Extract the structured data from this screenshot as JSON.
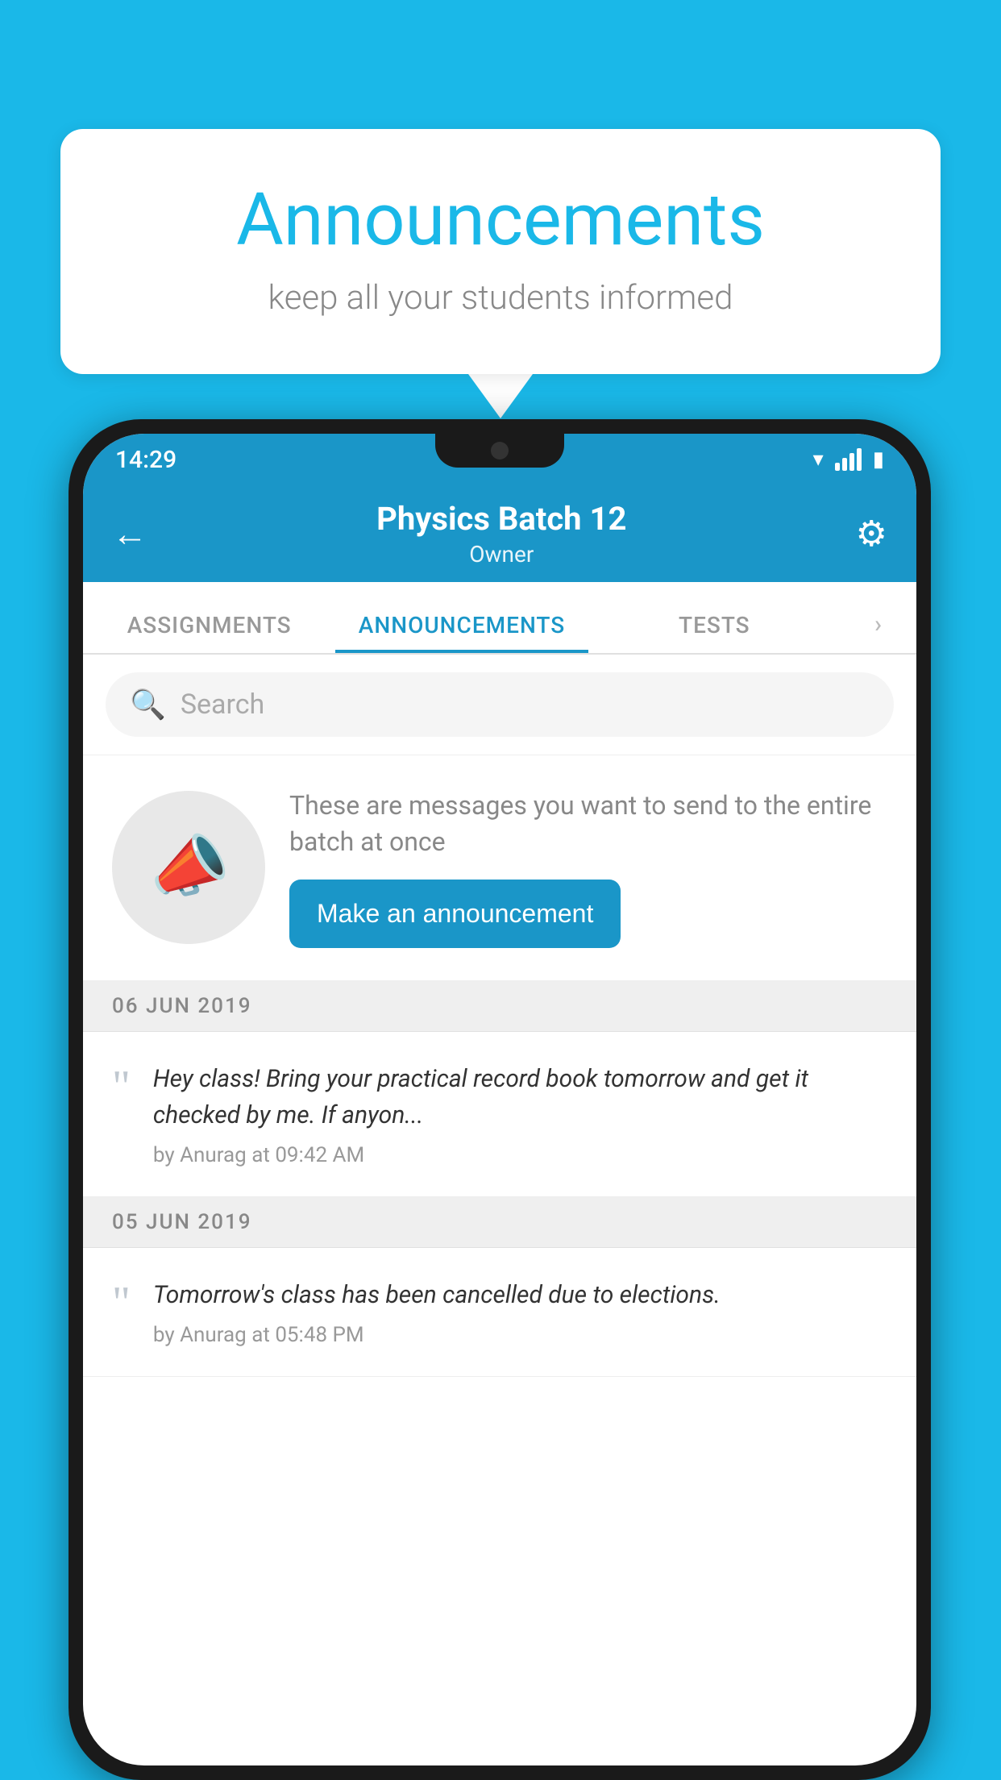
{
  "background_color": "#1ab8e8",
  "speech_bubble": {
    "title": "Announcements",
    "subtitle": "keep all your students informed"
  },
  "phone": {
    "status_bar": {
      "time": "14:29"
    },
    "header": {
      "title": "Physics Batch 12",
      "subtitle": "Owner",
      "back_label": "←",
      "settings_label": "⚙"
    },
    "tabs": [
      {
        "label": "ASSIGNMENTS",
        "active": false
      },
      {
        "label": "ANNOUNCEMENTS",
        "active": true
      },
      {
        "label": "TESTS",
        "active": false
      },
      {
        "label": "",
        "active": false
      }
    ],
    "search": {
      "placeholder": "Search"
    },
    "promo": {
      "text": "These are messages you want to send to the entire batch at once",
      "button_label": "Make an announcement"
    },
    "announcements": [
      {
        "date": "06  JUN  2019",
        "text": "Hey class! Bring your practical record book tomorrow and get it checked by me. If anyon...",
        "meta": "by Anurag at 09:42 AM"
      },
      {
        "date": "05  JUN  2019",
        "text": "Tomorrow's class has been cancelled due to elections.",
        "meta": "by Anurag at 05:48 PM"
      }
    ]
  }
}
